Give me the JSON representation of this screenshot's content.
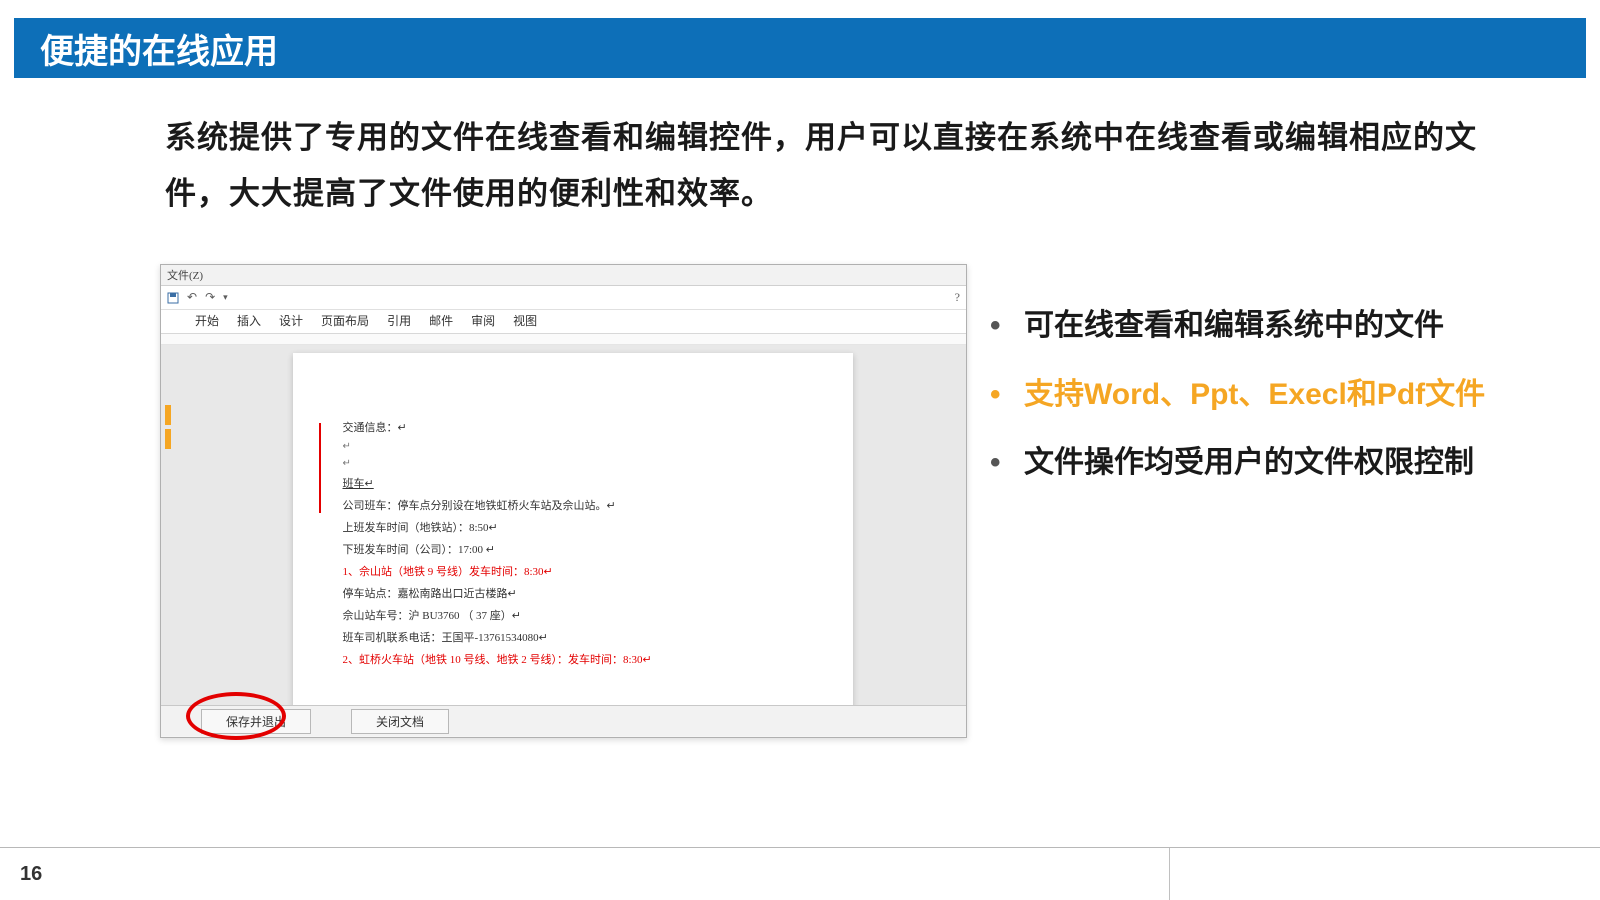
{
  "title": "便捷的在线应用",
  "body": "系统提供了专用的文件在线查看和编辑控件，用户可以直接在系统中在线查看或编辑相应的文件，大大提高了文件使用的便利性和效率。",
  "bullet_items": [
    {
      "text": "可在线查看和编辑系统中的文件",
      "highlight": false
    },
    {
      "text": "支持Word、Ppt、Execl和Pdf文件",
      "highlight": true
    },
    {
      "text": "文件操作均受用户的文件权限控制",
      "highlight": false
    }
  ],
  "editor": {
    "app_menu": "文件(Z)",
    "qat_help": "?",
    "ribbon_tabs": [
      "开始",
      "插入",
      "设计",
      "页面布局",
      "引用",
      "邮件",
      "审阅",
      "视图"
    ],
    "doc_lines": [
      {
        "text": "交通信息：↵",
        "cls": ""
      },
      {
        "text": "↵",
        "cls": "small"
      },
      {
        "text": "↵",
        "cls": "small"
      },
      {
        "text": "班车↵",
        "cls": ""
      },
      {
        "text": "公司班车：停车点分别设在地铁虹桥火车站及佘山站。↵",
        "cls": ""
      },
      {
        "text": "上班发车时间（地铁站）：8:50↵",
        "cls": ""
      },
      {
        "text": "下班发车时间（公司）：17:00 ↵",
        "cls": ""
      },
      {
        "text": "1、佘山站（地铁 9 号线）发车时间：8:30↵",
        "cls": "red"
      },
      {
        "text": "停车站点：嘉松南路出口近古楼路↵",
        "cls": ""
      },
      {
        "text": "佘山站车号：沪 BU3760 （ 37 座）↵",
        "cls": ""
      },
      {
        "text": "班车司机联系电话：王国平-13761534080↵",
        "cls": ""
      },
      {
        "text": "2、虹桥火车站（地铁 10 号线、地铁 2 号线）：发车时间：8:30↵",
        "cls": "red"
      }
    ],
    "footer_buttons": {
      "save_exit": "保存并退出",
      "close_doc": "关闭文档"
    }
  },
  "page_number": "16"
}
